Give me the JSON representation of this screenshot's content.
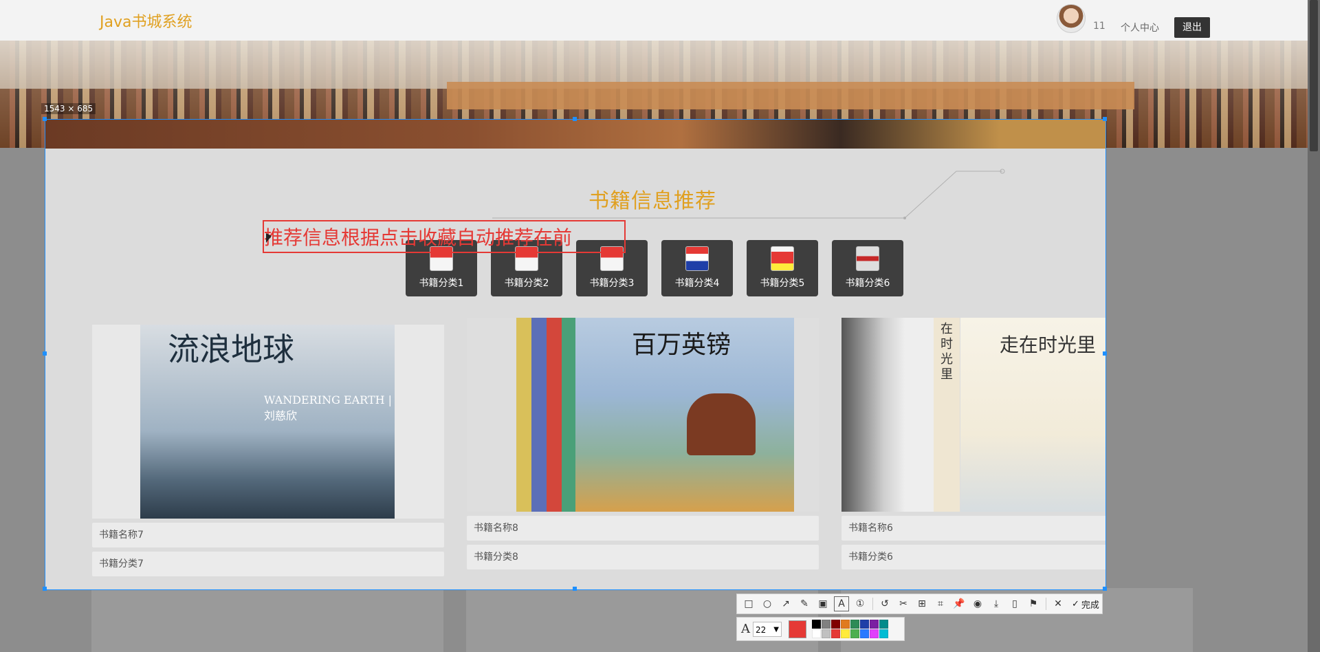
{
  "header": {
    "brand": "Java书城系统",
    "username": "11",
    "profile_link": "个人中心",
    "logout": "退出"
  },
  "carousel": {
    "slides": 3,
    "active_index": 1
  },
  "capture": {
    "size_label": "1543 × 685",
    "annotation_text": "推荐信息根据点击收藏自动推荐在前"
  },
  "section": {
    "title": "书籍信息推荐"
  },
  "categories": [
    {
      "label": "书籍分类1"
    },
    {
      "label": "书籍分类2"
    },
    {
      "label": "书籍分类3"
    },
    {
      "label": "书籍分类4"
    },
    {
      "label": "书籍分类5"
    },
    {
      "label": "书籍分类6"
    }
  ],
  "books": [
    {
      "name": "书籍名称7",
      "category": "书籍分类7",
      "cover_text": "WANDERING EARTH | 刘慈欣",
      "cover_title": "流浪地球"
    },
    {
      "name": "书籍名称8",
      "category": "书籍分类8",
      "cover_title": "百万英镑"
    },
    {
      "name": "书籍名称6",
      "category": "书籍分类6",
      "cover_title": "走在时光里",
      "spine_title": "在时光里"
    }
  ],
  "toolbar": {
    "icons": [
      "rectangle-icon",
      "ellipse-icon",
      "arrow-icon",
      "pen-icon",
      "mosaic-icon",
      "text-icon",
      "number-icon",
      "undo-icon",
      "cut-icon",
      "ocr-icon",
      "translate-icon",
      "pin-icon",
      "record-icon",
      "download-icon",
      "long-screenshot-icon",
      "bookmark-icon",
      "close-icon",
      "check-icon"
    ],
    "done_label": "完成",
    "font_size": "22",
    "current_color": "#e53935",
    "palette": [
      "#000000",
      "#808080",
      "#800000",
      "#e07a1f",
      "#2e8b57",
      "#1f3fa8",
      "#7b1fa2",
      "#008b8b",
      "#ffffff",
      "#c0c0c0",
      "#e53935",
      "#ffeb3b",
      "#4caf50",
      "#2979ff",
      "#e040fb",
      "#00bcd4"
    ]
  }
}
